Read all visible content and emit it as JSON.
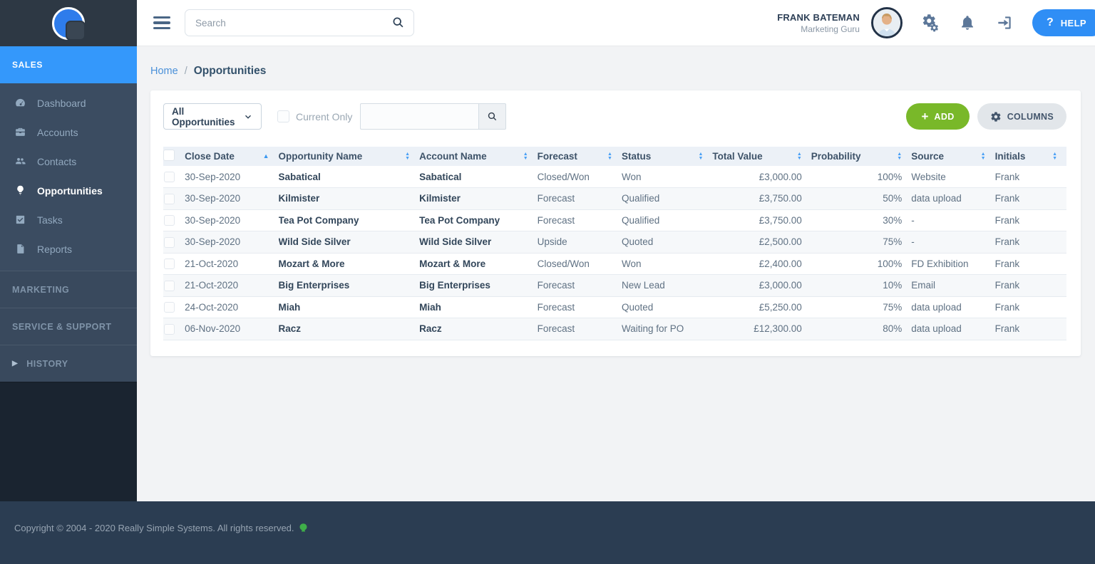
{
  "topbar": {
    "search_placeholder": "Search",
    "user": {
      "name": "FRANK BATEMAN",
      "role": "Marketing Guru"
    },
    "help": {
      "icon": "?",
      "label": "HELP"
    }
  },
  "sidebar": {
    "sales_label": "SALES",
    "items": [
      {
        "label": "Dashboard",
        "active": false
      },
      {
        "label": "Accounts",
        "active": false
      },
      {
        "label": "Contacts",
        "active": false
      },
      {
        "label": "Opportunities",
        "active": true
      },
      {
        "label": "Tasks",
        "active": false
      },
      {
        "label": "Reports",
        "active": false
      }
    ],
    "sections": [
      {
        "label": "MARKETING"
      },
      {
        "label": "SERVICE & SUPPORT"
      },
      {
        "label": "HISTORY",
        "expand_icon": "▶"
      }
    ]
  },
  "breadcrumb": {
    "home": "Home",
    "separator": "/",
    "current": "Opportunities"
  },
  "toolbar": {
    "view_filter_selected": "All Opportunities",
    "current_only_label": "Current Only",
    "search_value": "",
    "add_label": "ADD",
    "add_icon": "+",
    "columns_label": "COLUMNS"
  },
  "table": {
    "columns": [
      {
        "key": "close_date",
        "label": "Close Date",
        "sort": "asc"
      },
      {
        "key": "opportunity_name",
        "label": "Opportunity Name",
        "sort": "none"
      },
      {
        "key": "account_name",
        "label": "Account Name",
        "sort": "none"
      },
      {
        "key": "forecast",
        "label": "Forecast",
        "sort": "none"
      },
      {
        "key": "status",
        "label": "Status",
        "sort": "none"
      },
      {
        "key": "total_value",
        "label": "Total Value",
        "sort": "none"
      },
      {
        "key": "probability",
        "label": "Probability",
        "sort": "none"
      },
      {
        "key": "source",
        "label": "Source",
        "sort": "none"
      },
      {
        "key": "initials",
        "label": "Initials",
        "sort": "none"
      }
    ],
    "rows": [
      {
        "close_date": "30-Sep-2020",
        "opportunity_name": "Sabatical",
        "account_name": "Sabatical",
        "forecast": "Closed/Won",
        "status": "Won",
        "total_value": "£3,000.00",
        "probability": "100%",
        "source": "Website",
        "initials": "Frank"
      },
      {
        "close_date": "30-Sep-2020",
        "opportunity_name": "Kilmister",
        "account_name": "Kilmister",
        "forecast": "Forecast",
        "status": "Qualified",
        "total_value": "£3,750.00",
        "probability": "50%",
        "source": "data upload",
        "initials": "Frank"
      },
      {
        "close_date": "30-Sep-2020",
        "opportunity_name": "Tea Pot Company",
        "account_name": "Tea Pot Company",
        "forecast": "Forecast",
        "status": "Qualified",
        "total_value": "£3,750.00",
        "probability": "30%",
        "source": "-",
        "initials": "Frank"
      },
      {
        "close_date": "30-Sep-2020",
        "opportunity_name": "Wild Side Silver",
        "account_name": "Wild Side Silver",
        "forecast": "Upside",
        "status": "Quoted",
        "total_value": "£2,500.00",
        "probability": "75%",
        "source": "-",
        "initials": "Frank"
      },
      {
        "close_date": "21-Oct-2020",
        "opportunity_name": "Mozart & More",
        "account_name": "Mozart & More",
        "forecast": "Closed/Won",
        "status": "Won",
        "total_value": "£2,400.00",
        "probability": "100%",
        "source": "FD Exhibition",
        "initials": "Frank"
      },
      {
        "close_date": "21-Oct-2020",
        "opportunity_name": "Big Enterprises",
        "account_name": "Big Enterprises",
        "forecast": "Forecast",
        "status": "New Lead",
        "total_value": "£3,000.00",
        "probability": "10%",
        "source": "Email",
        "initials": "Frank"
      },
      {
        "close_date": "24-Oct-2020",
        "opportunity_name": "Miah",
        "account_name": "Miah",
        "forecast": "Forecast",
        "status": "Quoted",
        "total_value": "£5,250.00",
        "probability": "75%",
        "source": "data upload",
        "initials": "Frank"
      },
      {
        "close_date": "06-Nov-2020",
        "opportunity_name": "Racz",
        "account_name": "Racz",
        "forecast": "Forecast",
        "status": "Waiting for PO",
        "total_value": "£12,300.00",
        "probability": "80%",
        "source": "data upload",
        "initials": "Frank"
      }
    ]
  },
  "footer": {
    "copyright": "Copyright © 2004 - 2020 Really Simple Systems. All rights reserved."
  },
  "colors": {
    "accent_blue": "#3498fb",
    "add_green": "#79b829",
    "help_blue": "#2f8ef5",
    "sidebar_nav": "#3b4c61",
    "sidebar_dark": "#1a2430",
    "footer_navy": "#2b3d52",
    "header_row_bg": "#ecf1f7"
  }
}
